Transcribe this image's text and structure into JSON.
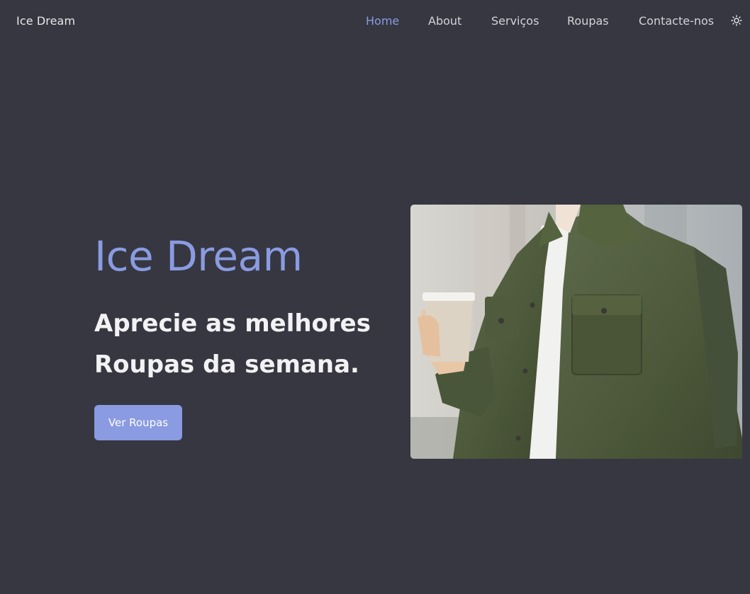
{
  "header": {
    "brand": "Ice Dream",
    "nav": [
      {
        "label": "Home",
        "active": true
      },
      {
        "label": "About",
        "active": false
      },
      {
        "label": "Serviços",
        "active": false
      },
      {
        "label": "Roupas",
        "active": false
      },
      {
        "label": "Contacte-nos",
        "active": false
      }
    ],
    "theme_toggle_icon": "sun-icon"
  },
  "hero": {
    "title": "Ice Dream",
    "subtitle": "Aprecie as melhores Roupas da semana.",
    "cta_label": "Ver Roupas",
    "image_icon": "person-in-green-jacket-holding-coffee-cup"
  },
  "colors": {
    "background": "#363741",
    "accent": "#8a9be1",
    "text": "#f2f2f4",
    "nav_text": "#d3d3d8"
  }
}
